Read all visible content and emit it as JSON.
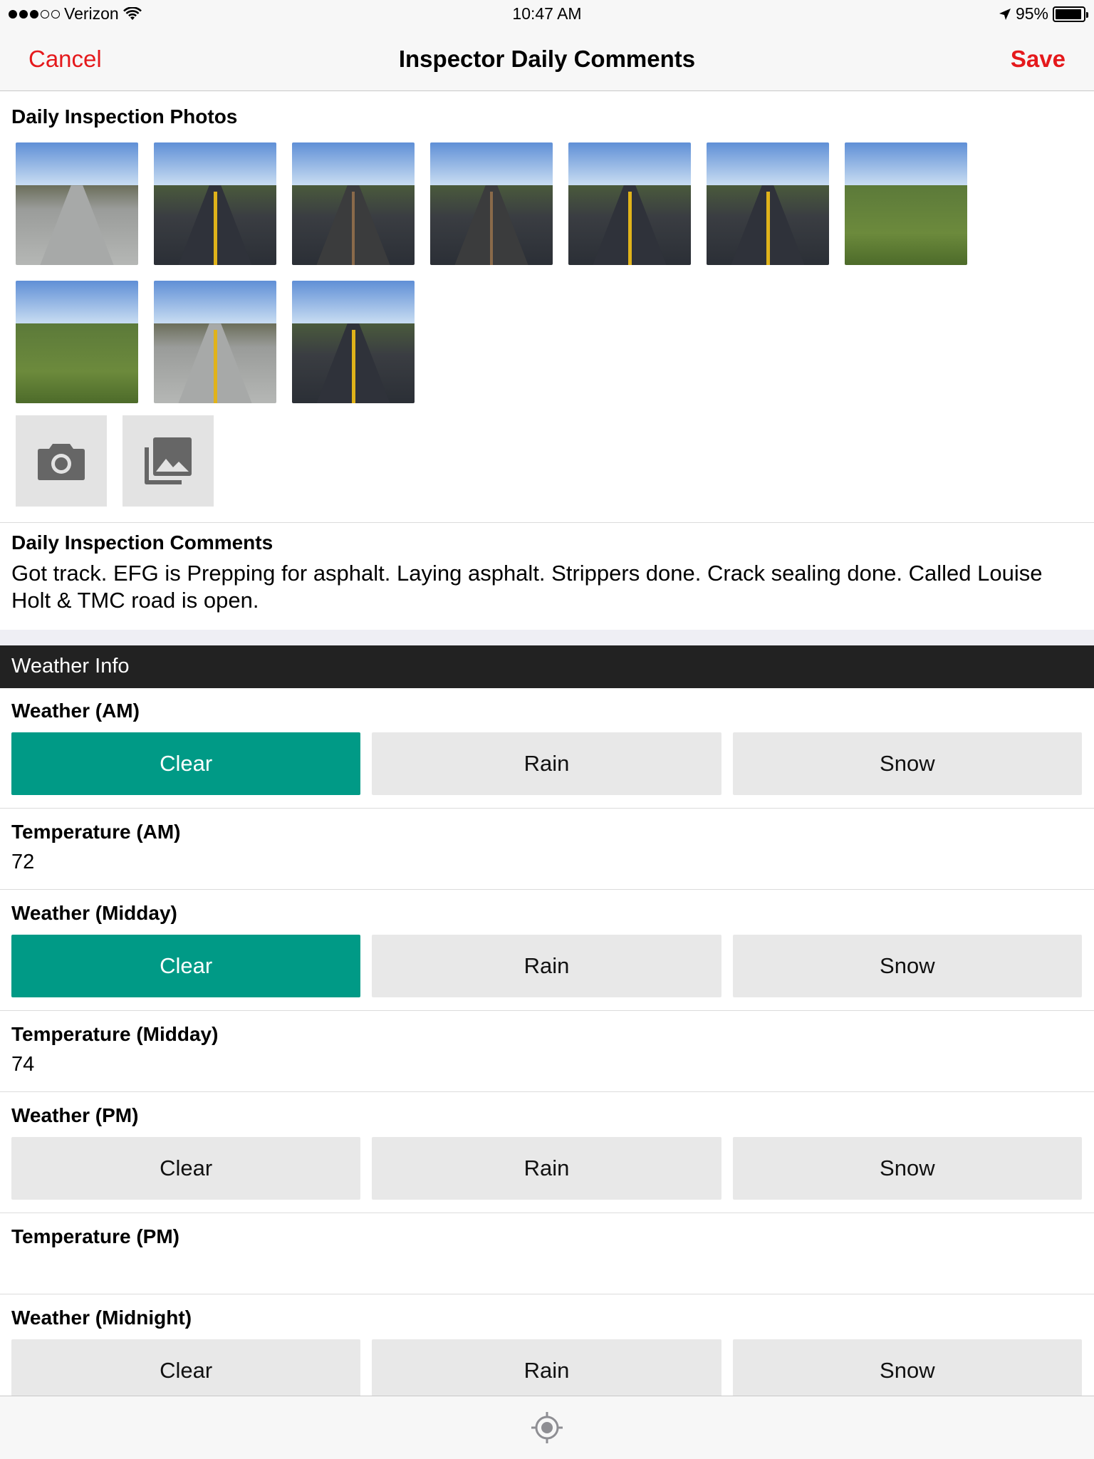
{
  "status_bar": {
    "carrier": "Verizon",
    "time": "10:47 AM",
    "battery": "95%",
    "battery_level": 0.95
  },
  "nav": {
    "cancel": "Cancel",
    "title": "Inspector Daily Comments",
    "save": "Save"
  },
  "photos": {
    "label": "Daily Inspection Photos",
    "count": 10,
    "camera_icon": "camera-icon",
    "library_icon": "photo-library-icon"
  },
  "comments": {
    "label": "Daily Inspection Comments",
    "text": "Got track. EFG is Prepping for asphalt. Laying asphalt. Strippers done. Crack sealing done. Called Louise Holt & TMC road is open."
  },
  "weather": {
    "header": "Weather Info",
    "options": [
      "Clear",
      "Rain",
      "Snow"
    ],
    "am": {
      "label": "Weather (AM)",
      "selected": "Clear"
    },
    "temp_am": {
      "label": "Temperature (AM)",
      "value": "72"
    },
    "midday": {
      "label": "Weather (Midday)",
      "selected": "Clear"
    },
    "temp_midday": {
      "label": "Temperature (Midday)",
      "value": "74"
    },
    "pm": {
      "label": "Weather (PM)",
      "selected": null
    },
    "temp_pm": {
      "label": "Temperature (PM)",
      "value": ""
    },
    "midnight": {
      "label": "Weather (Midnight)",
      "selected": null
    }
  },
  "colors": {
    "accent": "#e5191c",
    "selected": "#009a86",
    "header_bg": "#222222"
  },
  "tab_bar": {
    "icon": "location-target-icon"
  }
}
